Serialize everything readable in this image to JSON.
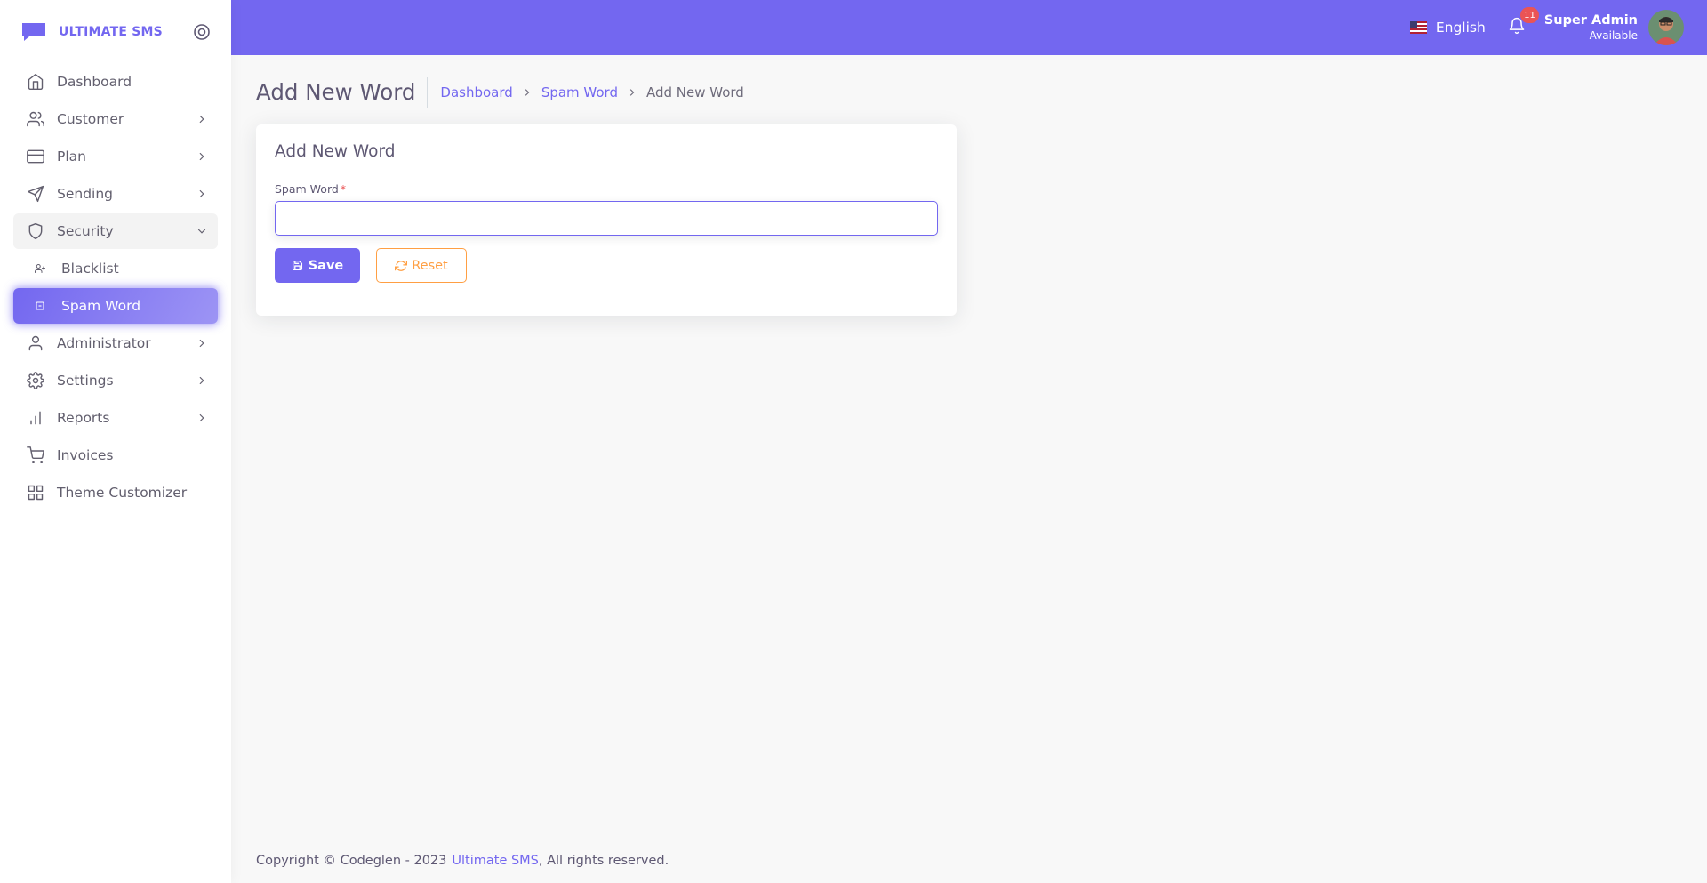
{
  "brand": {
    "name": "ULTIMATE SMS",
    "accent": "#7367f0"
  },
  "sidebar": {
    "items": [
      {
        "label": "Dashboard",
        "icon": "home-icon",
        "has_children": false
      },
      {
        "label": "Customer",
        "icon": "users-icon",
        "has_children": true
      },
      {
        "label": "Plan",
        "icon": "credit-card-icon",
        "has_children": true
      },
      {
        "label": "Sending",
        "icon": "send-icon",
        "has_children": true
      },
      {
        "label": "Security",
        "icon": "shield-icon",
        "has_children": true,
        "open": true,
        "children": [
          {
            "label": "Blacklist",
            "icon": "user-plus-icon"
          },
          {
            "label": "Spam Word",
            "icon": "square-icon",
            "active": true
          }
        ]
      },
      {
        "label": "Administrator",
        "icon": "user-icon",
        "has_children": true
      },
      {
        "label": "Settings",
        "icon": "gear-icon",
        "has_children": true
      },
      {
        "label": "Reports",
        "icon": "bar-chart-icon",
        "has_children": true
      },
      {
        "label": "Invoices",
        "icon": "shopping-cart-icon",
        "has_children": false
      },
      {
        "label": "Theme Customizer",
        "icon": "grid-icon",
        "has_children": false
      }
    ]
  },
  "header": {
    "language": "English",
    "notification_count": "11",
    "user_name": "Super Admin",
    "user_status": "Available"
  },
  "page": {
    "title": "Add New Word",
    "breadcrumb": [
      "Dashboard",
      "Spam Word",
      "Add New Word"
    ]
  },
  "form": {
    "card_title": "Add New Word",
    "field_label": "Spam Word",
    "required_mark": "*",
    "value": "",
    "save_label": "Save",
    "reset_label": "Reset"
  },
  "footer": {
    "copyright": "Copyright © Codeglen - 2023",
    "link_text": "Ultimate SMS",
    "suffix": ", All rights reserved."
  },
  "colors": {
    "primary": "#7367f0",
    "warning": "#ff9f43",
    "danger": "#ea5455"
  }
}
